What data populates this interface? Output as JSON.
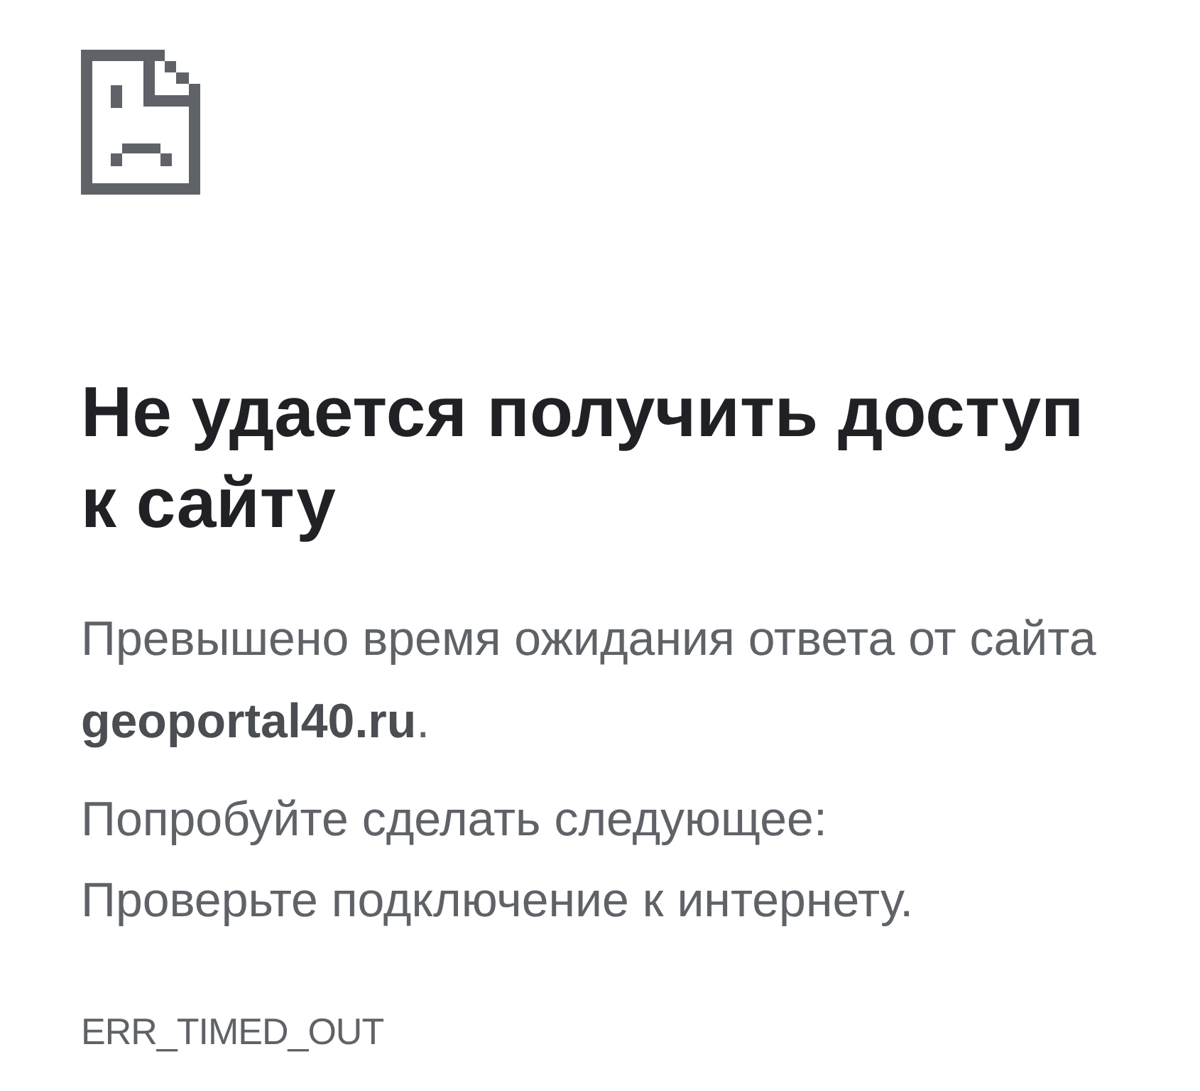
{
  "heading": "Не удается получить доступ к сайту",
  "message": "Превышено время ожидания ответа от сайта **geoportal40.ru**.",
  "suggestions": {
    "title": "Попробуйте сделать следующее:",
    "items": [
      "Проверьте подключение к интернету."
    ]
  },
  "error_code": "ERR_TIMED_OUT"
}
